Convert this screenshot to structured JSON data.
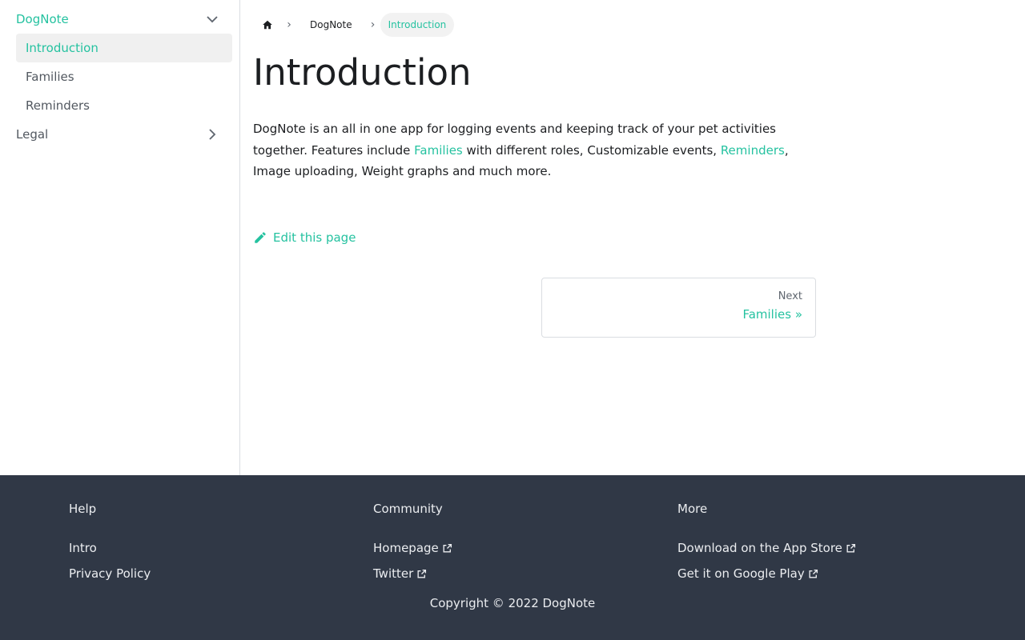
{
  "sidebar": {
    "categories": [
      {
        "label": "DogNote",
        "expanded": true,
        "items": [
          "Introduction",
          "Families",
          "Reminders"
        ]
      },
      {
        "label": "Legal",
        "expanded": false
      }
    ],
    "active_item": "Introduction"
  },
  "breadcrumbs": {
    "home_icon": "home-icon",
    "items": [
      "DogNote",
      "Introduction"
    ]
  },
  "page": {
    "title": "Introduction",
    "paragraph": {
      "part1": "DogNote is an all in one app for logging events and keeping track of your pet activities together. Features include ",
      "link1": "Families",
      "part2": " with different roles, Customizable events, ",
      "link2": "Reminders",
      "part3": ", Image uploading, Weight graphs and much more."
    },
    "edit_link": "Edit this page"
  },
  "pager": {
    "sub_label": "Next",
    "label": "Families »"
  },
  "footer": {
    "columns": [
      {
        "title": "Help",
        "links": [
          {
            "label": "Intro",
            "external": false
          },
          {
            "label": "Privacy Policy",
            "external": false
          }
        ]
      },
      {
        "title": "Community",
        "links": [
          {
            "label": "Homepage",
            "external": true
          },
          {
            "label": "Twitter",
            "external": true
          }
        ]
      },
      {
        "title": "More",
        "links": [
          {
            "label": "Download on the App Store",
            "external": true
          },
          {
            "label": "Get it on Google Play",
            "external": true
          }
        ]
      }
    ],
    "copyright": "Copyright © 2022 DogNote"
  },
  "colors": {
    "accent": "#25c2a0",
    "footer_bg": "#303846",
    "text": "#1c1e21"
  }
}
